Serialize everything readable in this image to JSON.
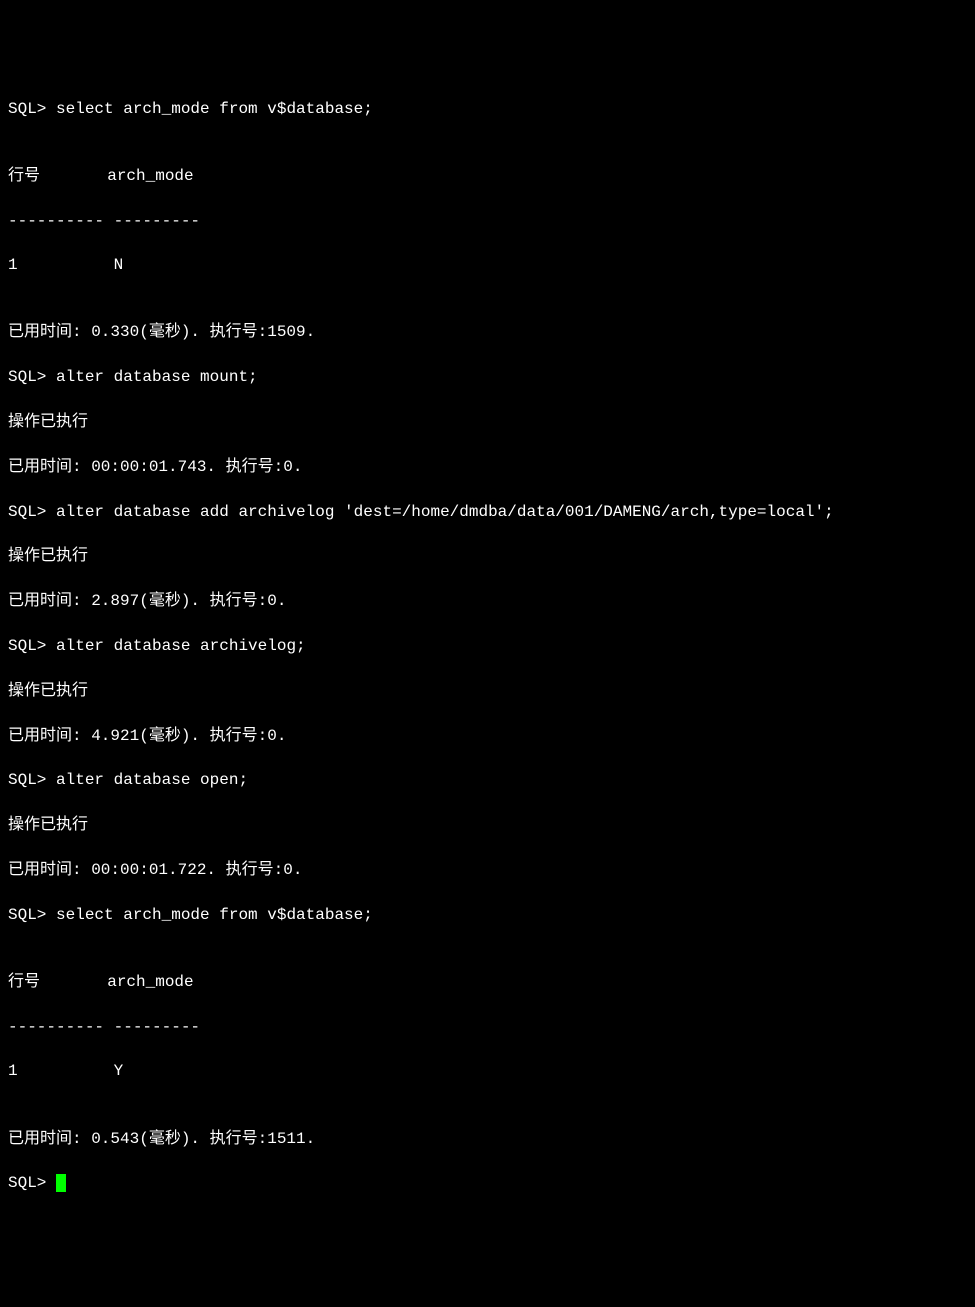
{
  "prompt": "SQL>",
  "lines": {
    "l1": "SQL> select arch_mode from v$database;",
    "l2": "",
    "l3": "行号       arch_mode",
    "l4": "---------- ---------",
    "l5": "1          N",
    "l6": "",
    "l7": "已用时间: 0.330(毫秒). 执行号:1509.",
    "l8": "SQL> alter database mount;",
    "l9": "操作已执行",
    "l10": "已用时间: 00:00:01.743. 执行号:0.",
    "l11": "SQL> alter database add archivelog 'dest=/home/dmdba/data/001/DAMENG/arch,type=local';",
    "l12": "操作已执行",
    "l13": "已用时间: 2.897(毫秒). 执行号:0.",
    "l14": "SQL> alter database archivelog;",
    "l15": "操作已执行",
    "l16": "已用时间: 4.921(毫秒). 执行号:0.",
    "l17": "SQL> alter database open;",
    "l18": "操作已执行",
    "l19": "已用时间: 00:00:01.722. 执行号:0.",
    "l20": "SQL> select arch_mode from v$database;",
    "l21": "",
    "l22": "行号       arch_mode",
    "l23": "---------- ---------",
    "l24": "1          Y",
    "l25": "",
    "l26": "已用时间: 0.543(毫秒). 执行号:1511.",
    "l27": "SQL> "
  }
}
